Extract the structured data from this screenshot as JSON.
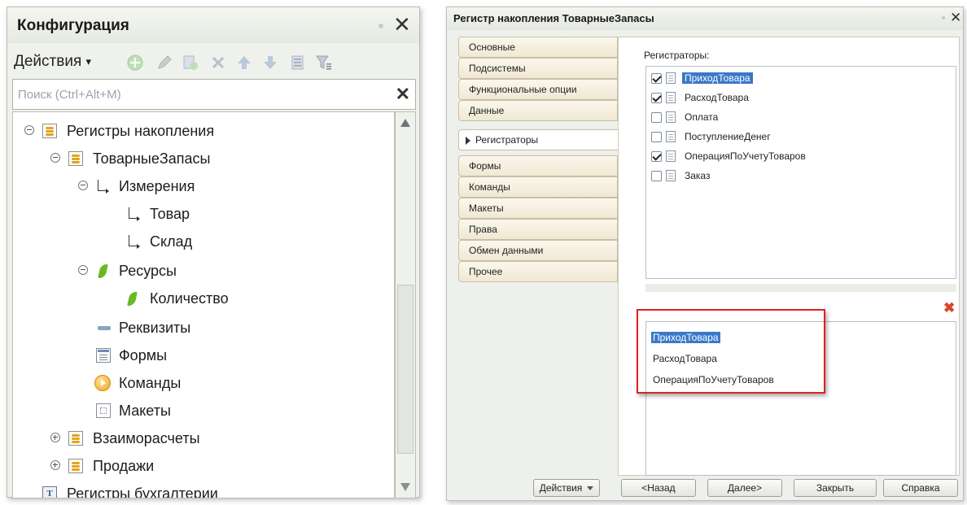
{
  "left_panel": {
    "title": "Конфигурация",
    "actions_label": "Действия",
    "search_placeholder": "Поиск (Ctrl+Alt+M)",
    "tree": [
      {
        "label": "Регистры накопления",
        "icon": "accumulation-register-icon",
        "state": "expanded"
      },
      {
        "label": "ТоварныеЗапасы",
        "icon": "accumulation-register-icon",
        "state": "expanded"
      },
      {
        "label": "Измерения",
        "icon": "dimension-icon",
        "state": "expanded"
      },
      {
        "label": "Товар",
        "icon": "dimension-icon"
      },
      {
        "label": "Склад",
        "icon": "dimension-icon"
      },
      {
        "label": "Ресурсы",
        "icon": "resource-icon",
        "state": "expanded"
      },
      {
        "label": "Количество",
        "icon": "resource-icon"
      },
      {
        "label": "Реквизиты",
        "icon": "attribute-icon"
      },
      {
        "label": "Формы",
        "icon": "form-icon"
      },
      {
        "label": "Команды",
        "icon": "command-icon"
      },
      {
        "label": "Макеты",
        "icon": "template-icon"
      },
      {
        "label": "Взаиморасчеты",
        "icon": "accumulation-register-icon",
        "state": "collapsed"
      },
      {
        "label": "Продажи",
        "icon": "accumulation-register-icon",
        "state": "collapsed"
      },
      {
        "label": "Регистры бухгалтерии",
        "icon": "accounting-register-icon"
      }
    ]
  },
  "right_panel": {
    "title": "Регистр накопления ТоварныеЗапасы",
    "tabs": [
      {
        "label": "Основные"
      },
      {
        "label": "Подсистемы"
      },
      {
        "label": "Функциональные опции"
      },
      {
        "label": "Данные"
      },
      {
        "label": "Регистраторы",
        "active": true
      },
      {
        "label": "Формы"
      },
      {
        "label": "Команды"
      },
      {
        "label": "Макеты"
      },
      {
        "label": "Права"
      },
      {
        "label": "Обмен данными"
      },
      {
        "label": "Прочее"
      }
    ],
    "registrators_label": "Регистраторы:",
    "registrators": [
      {
        "label": "ПриходТовара",
        "checked": true,
        "selected": true
      },
      {
        "label": "РасходТовара",
        "checked": true
      },
      {
        "label": "Оплата",
        "checked": false
      },
      {
        "label": "ПоступлениеДенег",
        "checked": false
      },
      {
        "label": "ОперацияПоУчетуТоваров",
        "checked": true
      },
      {
        "label": "Заказ",
        "checked": false
      }
    ],
    "selected_registrators": [
      "ПриходТовара",
      "РасходТовара",
      "ОперацияПоУчетуТоваров"
    ],
    "buttons": {
      "actions": "Действия",
      "back": "<Назад",
      "next": "Далее>",
      "close": "Закрыть",
      "help": "Справка"
    }
  },
  "colors": {
    "selection": "#3a78c8",
    "highlight_frame": "#e02020",
    "tab_fill": "#f0e8d3"
  }
}
